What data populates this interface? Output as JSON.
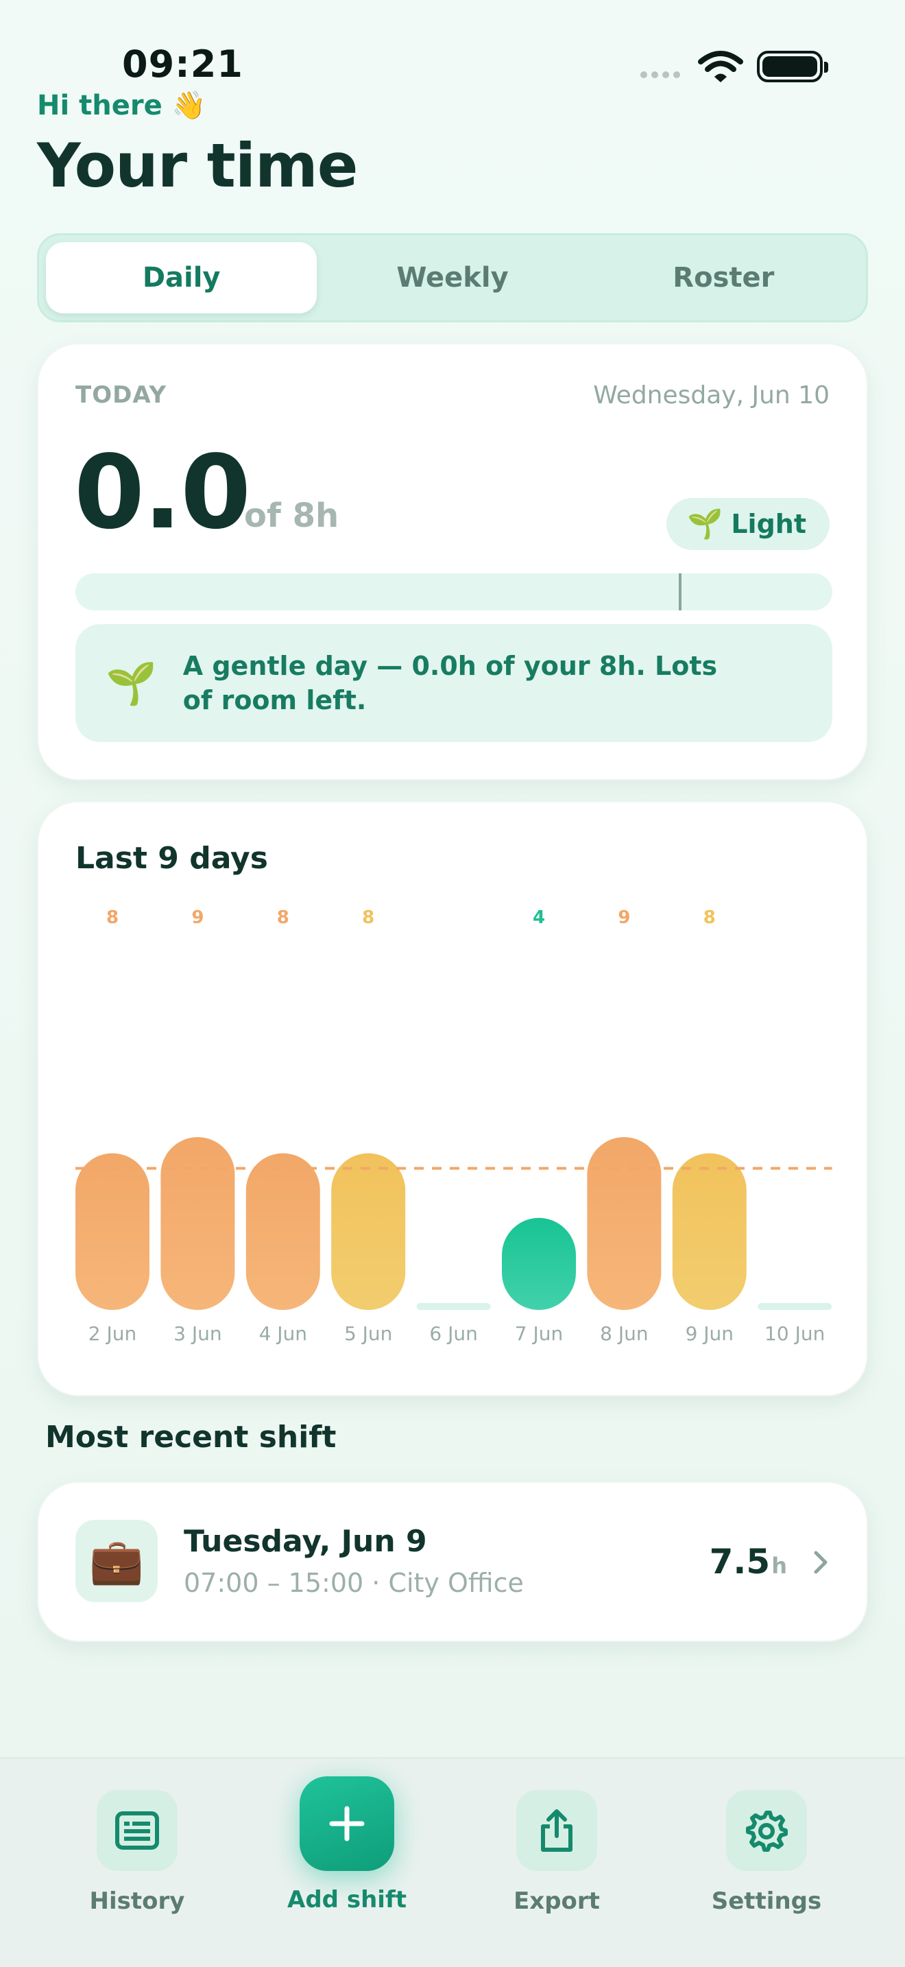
{
  "status_bar": {
    "time": "09:21"
  },
  "header": {
    "greeting": "Hi there 👋",
    "title": "Your time"
  },
  "tabs": [
    {
      "label": "Daily",
      "active": true
    },
    {
      "label": "Weekly",
      "active": false
    },
    {
      "label": "Roster",
      "active": false
    }
  ],
  "today": {
    "label": "TODAY",
    "date": "Wednesday, Jun 10",
    "hours": "0.0",
    "goal": "of 8h",
    "level_label": "Light",
    "progress_fraction": 0.0,
    "note": "A gentle day — 0.0h of your 8h. Lots of room left."
  },
  "chart": {
    "title": "Last 9 days"
  },
  "chart_data": {
    "type": "bar",
    "categories": [
      "2 Jun",
      "3 Jun",
      "4 Jun",
      "5 Jun",
      "6 Jun",
      "7 Jun",
      "8 Jun",
      "9 Jun",
      "10 Jun"
    ],
    "values": [
      8,
      9,
      8,
      8,
      0,
      4,
      9,
      8,
      0
    ],
    "data_labels": [
      "8",
      "9",
      "8",
      "8",
      "",
      "4",
      "9",
      "8",
      ""
    ],
    "target": 8,
    "ylim": [
      0,
      9
    ],
    "colors": {
      "over": [
        "#f2a768",
        "#f6b679"
      ],
      "near": [
        "#f1c25c",
        "#f2cd6e"
      ],
      "under": [
        "#18c493",
        "#42d1ab"
      ],
      "empty": "#d9f3ea",
      "target_line": "#f2a768"
    },
    "label_colors": [
      "#f2a768",
      "#f2a768",
      "#f2a768",
      "#f1c25c",
      "",
      "#1fbf93",
      "#f2a768",
      "#f1c25c",
      ""
    ]
  },
  "recent": {
    "section_title": "Most recent shift",
    "icon": "briefcase-icon",
    "date": "Tuesday, Jun 9",
    "meta": "07:00 – 15:00 · City Office",
    "hours": "7.5",
    "unit": "h"
  },
  "nav": {
    "history": "History",
    "add": "Add shift",
    "export": "Export",
    "settings": "Settings"
  }
}
